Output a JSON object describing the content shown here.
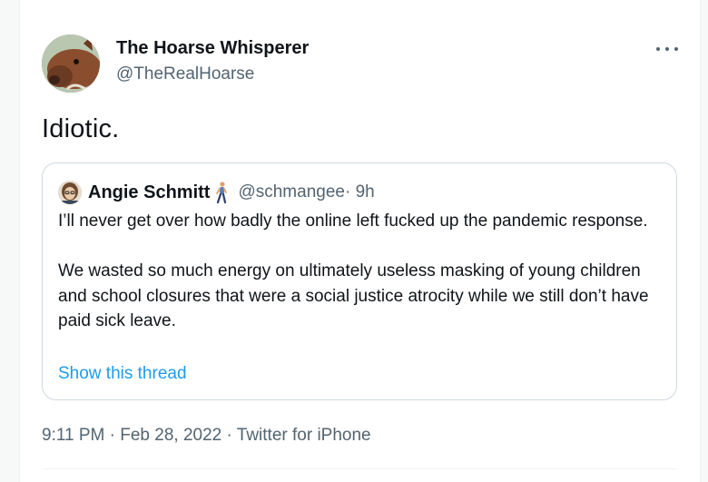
{
  "author": {
    "name": "The Hoarse Whisperer",
    "handle": "@TheRealHoarse",
    "avatar_icon": "horse-avatar"
  },
  "more_icon": "more-options-icon",
  "tweet": {
    "text": "Idiotic."
  },
  "quoted": {
    "name": "Angie Schmitt",
    "emoji_icon": "person-walking-emoji",
    "handle": "@schmangee",
    "time": " · 9h",
    "paragraphs": [
      "I’ll never get over how badly the online left fucked up the pandemic response.",
      "We wasted so much energy on ultimately useless masking of young children and school closures that were a social justice atrocity while we still don’t have paid sick leave."
    ],
    "show_thread": "Show this thread"
  },
  "meta": {
    "time": "9:11 PM",
    "sep1": " · ",
    "date": "Feb 28, 2022",
    "sep2": " · ",
    "source": "Twitter for iPhone"
  },
  "colors": {
    "link": "#1d9bf0",
    "secondary_text": "#536471",
    "border": "#cfd9de"
  }
}
